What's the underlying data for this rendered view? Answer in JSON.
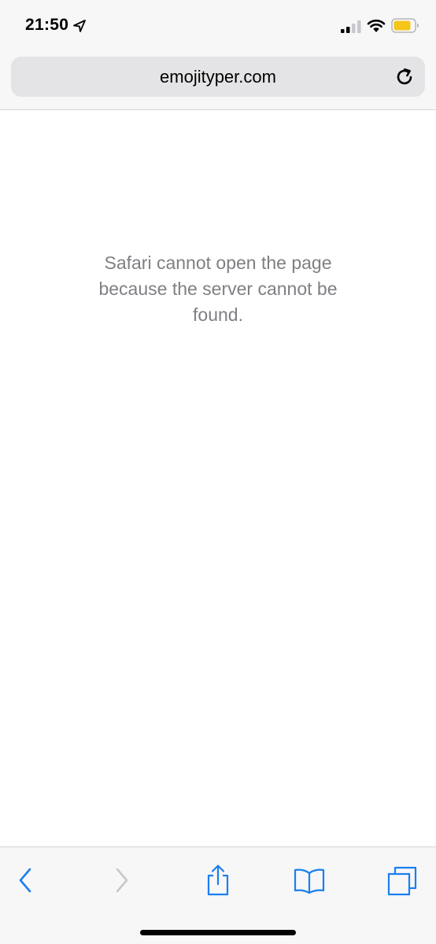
{
  "status_bar": {
    "time": "21:50",
    "icons": [
      "location-arrow-icon",
      "signal-icon",
      "wifi-icon",
      "battery-icon"
    ],
    "battery_color": "#f5c518"
  },
  "address_bar": {
    "url": "emojityper.com",
    "reload_icon": "reload-icon"
  },
  "content": {
    "error_message": "Safari cannot open the page because the server cannot be found."
  },
  "toolbar": {
    "items": [
      {
        "name": "back",
        "icon": "chevron-left-icon",
        "enabled": true
      },
      {
        "name": "forward",
        "icon": "chevron-right-icon",
        "enabled": false
      },
      {
        "name": "share",
        "icon": "share-icon",
        "enabled": true
      },
      {
        "name": "bookmarks",
        "icon": "book-icon",
        "enabled": true
      },
      {
        "name": "tabs",
        "icon": "tabs-icon",
        "enabled": true
      }
    ],
    "accent_color": "#1a7ff0",
    "disabled_color": "#c7c7cc"
  }
}
